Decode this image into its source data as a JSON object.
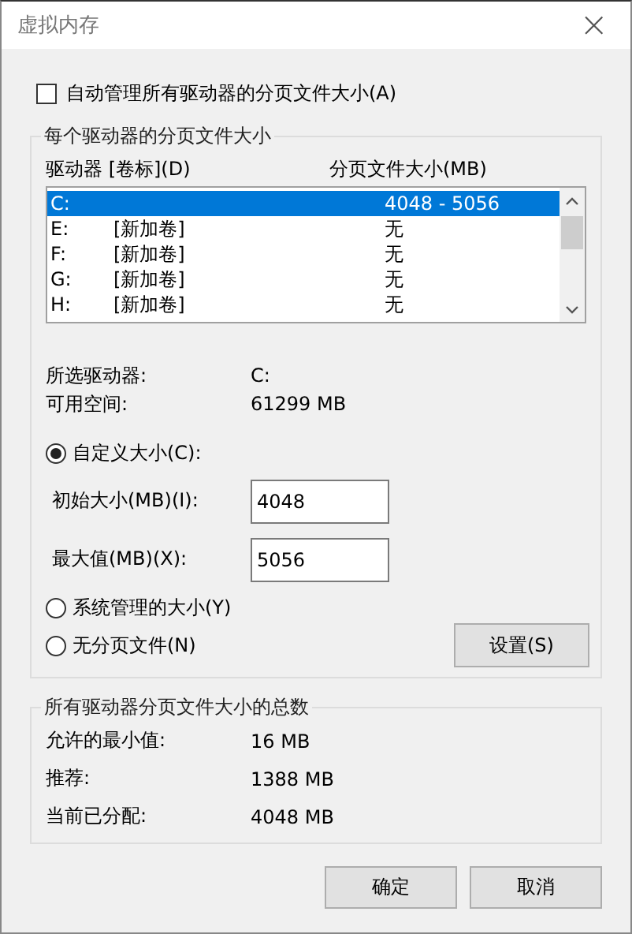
{
  "window": {
    "title": "虚拟内存",
    "close": "×"
  },
  "auto_manage": {
    "label": "自动管理所有驱动器的分页文件大小(A)",
    "checked": false
  },
  "per_drive": {
    "title": "每个驱动器的分页文件大小",
    "columns": [
      "驱动器 [卷标](D)",
      "分页文件大小(MB)"
    ],
    "drives": [
      {
        "drive": "C:",
        "size": "4048 - 5056",
        "selected": true
      },
      {
        "drive": "E:",
        "label": "[新加卷]",
        "size": "无",
        "selected": false
      },
      {
        "drive": "F:",
        "label": "[新加卷]",
        "size": "无",
        "selected": false
      },
      {
        "drive": "G:",
        "label": "[新加卷]",
        "size": "无",
        "selected": false
      },
      {
        "drive": "H:",
        "label": "[新加卷]",
        "size": "无",
        "selected": false
      }
    ],
    "info": [
      {
        "label": "所选驱动器:",
        "value": "C:"
      },
      {
        "label": "可用空间:",
        "value": "61299 MB"
      }
    ],
    "options": [
      {
        "label": "自定义大小(C):",
        "selected": true,
        "fields": [
          {
            "label": "初始大小(MB)(I):",
            "value": "4048"
          },
          {
            "label": "最大值(MB)(X):",
            "value": "5056"
          }
        ]
      },
      {
        "label": "系统管理的大小(Y)",
        "selected": false
      },
      {
        "label": "无分页文件(N)",
        "selected": false
      }
    ],
    "set_button": "设置(S)"
  },
  "totals": {
    "title": "所有驱动器分页文件大小的总数",
    "rows": [
      {
        "label": "允许的最小值:",
        "value": "16 MB"
      },
      {
        "label": "推荐:",
        "value": "1388 MB"
      },
      {
        "label": "当前已分配:",
        "value": "4048 MB"
      }
    ]
  },
  "buttons": [
    "确定",
    "取消"
  ]
}
